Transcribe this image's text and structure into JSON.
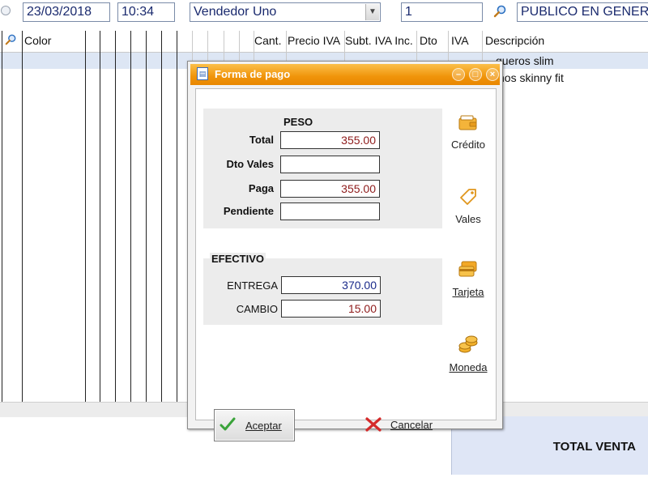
{
  "topbar": {
    "date": "23/03/2018",
    "time": "10:34",
    "seller": "Vendedor Uno",
    "quantity": "1",
    "customer": "PUBLICO EN GENERA"
  },
  "grid": {
    "columns": {
      "color": "Color",
      "cant": "Cant.",
      "precio": "Precio IVA",
      "subt": "Subt. IVA Inc.",
      "dto": "Dto",
      "iva": "IVA",
      "descripcion": "Descripción"
    },
    "rows": [
      {
        "descripcion": "queros slim"
      },
      {
        "descripcion": "nos skinny fit"
      }
    ]
  },
  "total_label": "TOTAL VENTA",
  "dialog": {
    "title": "Forma de pago",
    "peso_section": {
      "heading": "PESO",
      "total_label": "Total",
      "total_value": "355.00",
      "dto_vales_label": "Dto Vales",
      "dto_vales_value": "",
      "paga_label": "Paga",
      "paga_value": "355.00",
      "pendiente_label": "Pendiente",
      "pendiente_value": ""
    },
    "efectivo_section": {
      "heading": "EFECTIVO",
      "entrega_label": "ENTREGA",
      "entrega_value": "370.00",
      "cambio_label": "CAMBIO",
      "cambio_value": "15.00"
    },
    "side_buttons": {
      "credito": "Crédito",
      "vales": "Vales",
      "tarjeta": "Tarjeta",
      "moneda": "Moneda"
    },
    "accept_label": "Aceptar",
    "cancel_label": "Cancelar"
  },
  "colors": {
    "titlebar": "#f0940a",
    "value_red": "#8e1b1b",
    "value_blue": "#1a2a8a",
    "total_box": "#dfe6f6"
  }
}
